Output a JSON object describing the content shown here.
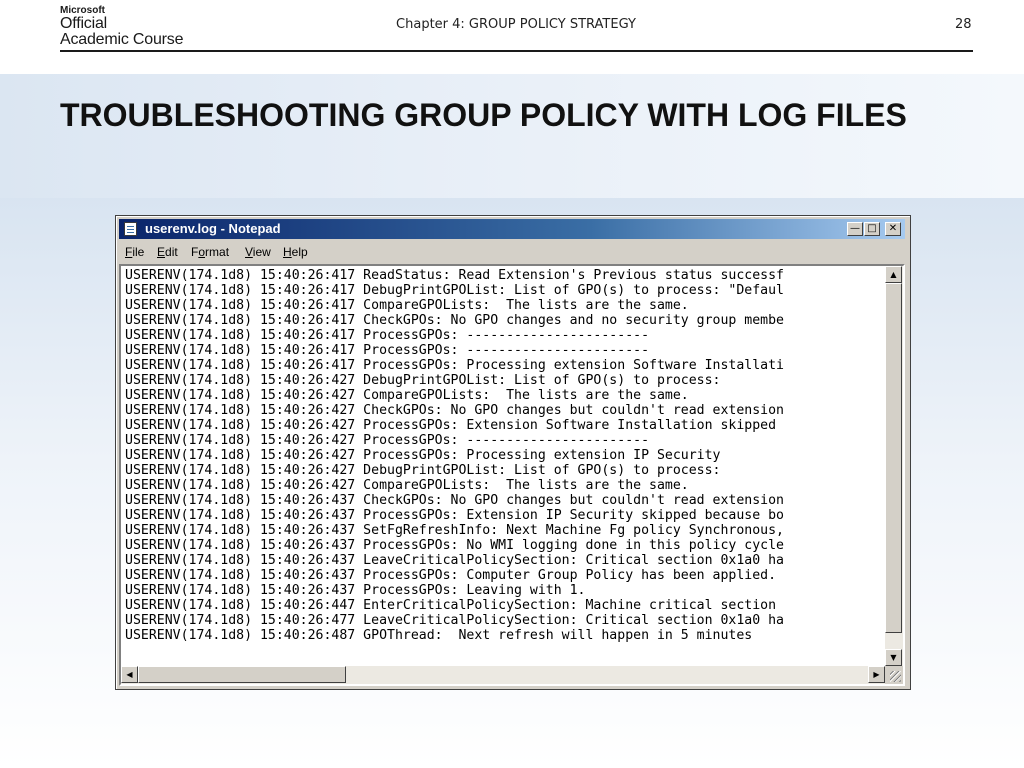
{
  "slide": {
    "logo": {
      "brand": "Microsoft",
      "line1": "Official",
      "line2": "Academic Course"
    },
    "chapter": "Chapter 4: GROUP POLICY STRATEGY",
    "page_number": "28",
    "title": "TROUBLESHOOTING GROUP POLICY WITH LOG FILES"
  },
  "window": {
    "title": "userenv.log - Notepad",
    "icon": "notepad-icon",
    "buttons": {
      "minimize": "minimize-icon",
      "maximize": "maximize-icon",
      "close": "close-icon"
    },
    "menu": [
      {
        "accel": "F",
        "rest": "ile"
      },
      {
        "accel": "E",
        "rest": "dit"
      },
      {
        "pre": "F",
        "accel": "o",
        "rest": "rmat"
      },
      {
        "accel": "V",
        "rest": "iew"
      },
      {
        "accel": "H",
        "rest": "elp"
      }
    ],
    "content": "USERENV(174.1d8) 15:40:26:417 ReadStatus: Read Extension's Previous status successf\nUSERENV(174.1d8) 15:40:26:417 DebugPrintGPOList: List of GPO(s) to process: \"Defaul\nUSERENV(174.1d8) 15:40:26:417 CompareGPOLists:  The lists are the same.\nUSERENV(174.1d8) 15:40:26:417 CheckGPOs: No GPO changes and no security group membe\nUSERENV(174.1d8) 15:40:26:417 ProcessGPOs: -----------------------\nUSERENV(174.1d8) 15:40:26:417 ProcessGPOs: -----------------------\nUSERENV(174.1d8) 15:40:26:417 ProcessGPOs: Processing extension Software Installati\nUSERENV(174.1d8) 15:40:26:427 DebugPrintGPOList: List of GPO(s) to process:\nUSERENV(174.1d8) 15:40:26:427 CompareGPOLists:  The lists are the same.\nUSERENV(174.1d8) 15:40:26:427 CheckGPOs: No GPO changes but couldn't read extension\nUSERENV(174.1d8) 15:40:26:427 ProcessGPOs: Extension Software Installation skipped \nUSERENV(174.1d8) 15:40:26:427 ProcessGPOs: -----------------------\nUSERENV(174.1d8) 15:40:26:427 ProcessGPOs: Processing extension IP Security\nUSERENV(174.1d8) 15:40:26:427 DebugPrintGPOList: List of GPO(s) to process:\nUSERENV(174.1d8) 15:40:26:427 CompareGPOLists:  The lists are the same.\nUSERENV(174.1d8) 15:40:26:437 CheckGPOs: No GPO changes but couldn't read extension\nUSERENV(174.1d8) 15:40:26:437 ProcessGPOs: Extension IP Security skipped because bo\nUSERENV(174.1d8) 15:40:26:437 SetFgRefreshInfo: Next Machine Fg policy Synchronous,\nUSERENV(174.1d8) 15:40:26:437 ProcessGPOs: No WMI logging done in this policy cycle\nUSERENV(174.1d8) 15:40:26:437 LeaveCriticalPolicySection: Critical section 0x1a0 ha\nUSERENV(174.1d8) 15:40:26:437 ProcessGPOs: Computer Group Policy has been applied.\nUSERENV(174.1d8) 15:40:26:437 ProcessGPOs: Leaving with 1.\nUSERENV(174.1d8) 15:40:26:447 EnterCriticalPolicySection: Machine critical section \nUSERENV(174.1d8) 15:40:26:477 LeaveCriticalPolicySection: Critical section 0x1a0 ha\nUSERENV(174.1d8) 15:40:26:487 GPOThread:  Next refresh will happen in 5 minutes"
  },
  "colors": {
    "titlebar_start": "#0a246a",
    "titlebar_end": "#a6caf0",
    "chrome": "#d4d0c8"
  }
}
